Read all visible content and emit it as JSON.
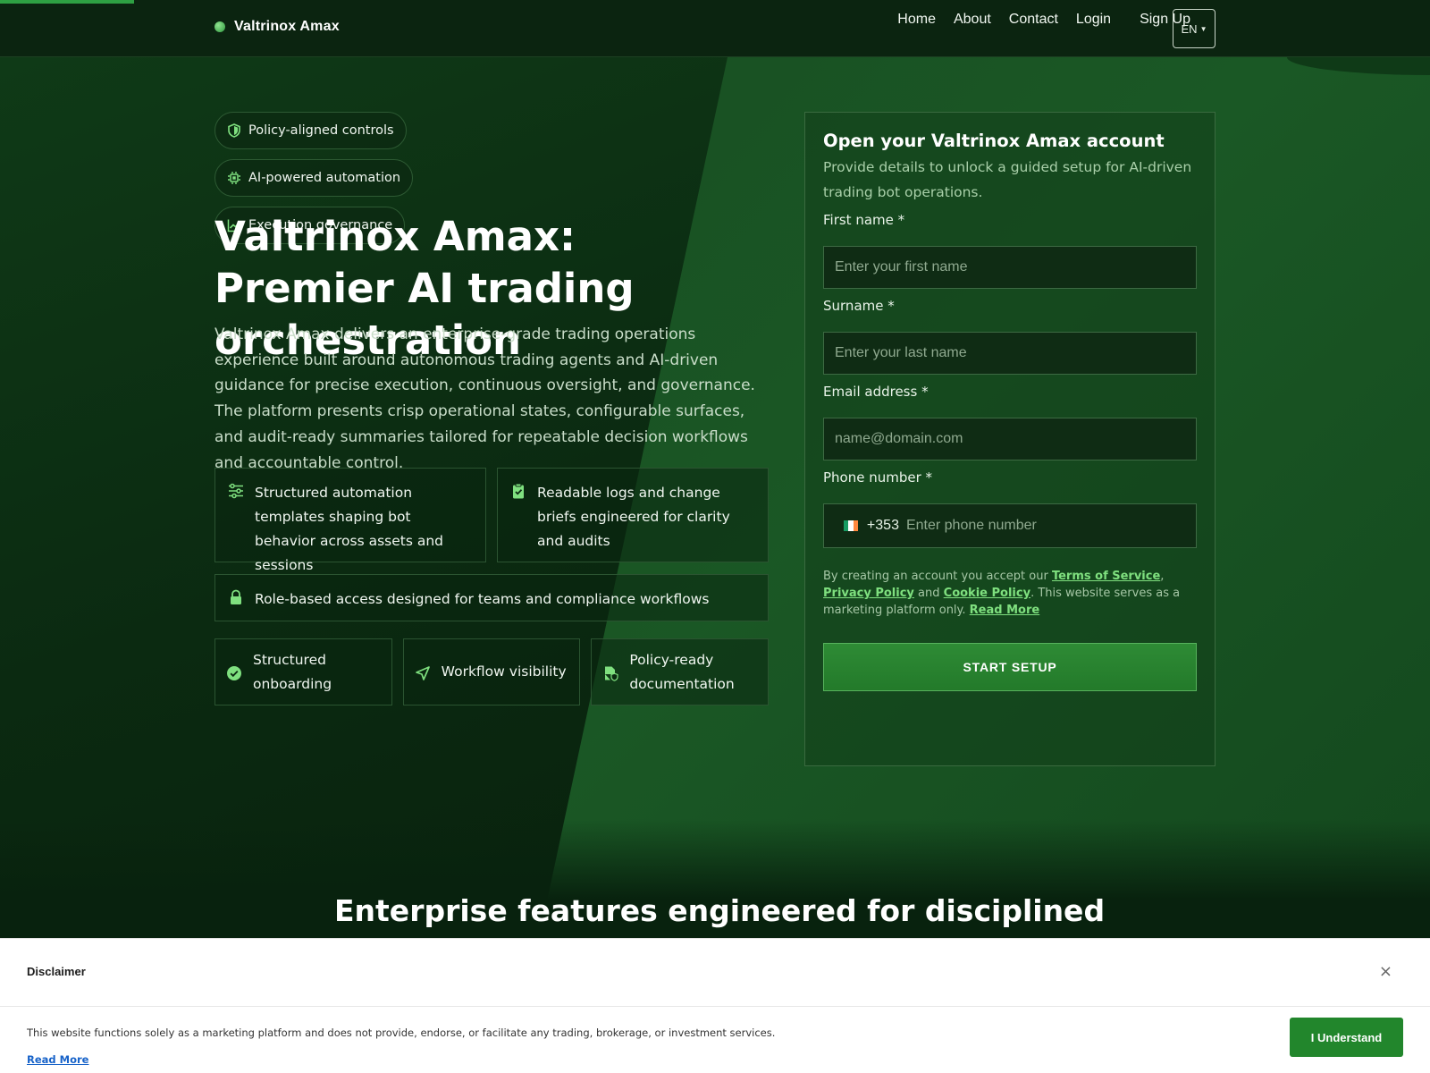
{
  "brand": {
    "name": "Valtrinox Amax"
  },
  "nav": {
    "home": "Home",
    "about": "About",
    "contact": "Contact",
    "login": "Login",
    "signup": "Sign Up",
    "language": "EN"
  },
  "hero": {
    "chips": [
      "Policy-aligned controls",
      "AI-powered automation",
      "Execution governance"
    ],
    "title": "Valtrinox Amax: Premier AI trading orchestration",
    "description": "Valtrinox Amax delivers an enterprise-grade trading operations experience built around autonomous trading agents and AI-driven guidance for precise execution, continuous oversight, and governance. The platform presents crisp operational states, configurable surfaces, and audit-ready summaries tailored for repeatable decision workflows and accountable control.",
    "features": [
      "Structured automation templates shaping bot behavior across assets and sessions",
      "Readable logs and change briefs engineered for clarity and audits",
      "Role-based access designed for teams and compliance workflows"
    ],
    "highlights": [
      "Structured onboarding",
      "Workflow visibility",
      "Policy-ready documentation"
    ]
  },
  "form": {
    "title": "Open your Valtrinox Amax account",
    "subtitle": "Provide details to unlock a guided setup for AI-driven trading bot operations.",
    "first_name_label": "First name *",
    "first_name_placeholder": "Enter your first name",
    "surname_label": "Surname *",
    "surname_placeholder": "Enter your last name",
    "email_label": "Email address *",
    "email_placeholder": "name@domain.com",
    "phone_label": "Phone number *",
    "phone_code": "+353",
    "phone_placeholder": "Enter phone number",
    "legal_prefix": "By creating an account you accept our",
    "terms": "Terms of Service",
    "privacy": "Privacy Policy",
    "and": "and",
    "cookie": "Cookie Policy",
    "legal_suffix": ". This website serves as a marketing platform only.",
    "read_more": "Read More",
    "submit": "START SETUP"
  },
  "section": {
    "title": "Enterprise features engineered for disciplined"
  },
  "disclaimer": {
    "title": "Disclaimer",
    "close": "×",
    "text": "This website functions solely as a marketing platform and does not provide, endorse, or facilitate any trading, brokerage, or investment services.",
    "read_more": "Read More",
    "button": "I Understand"
  },
  "colors": {
    "accent": "#2ea043",
    "link": "#7fe07f",
    "disclaimer_link": "#1863c9",
    "button": "#22862c"
  },
  "page_progress": 0.094
}
